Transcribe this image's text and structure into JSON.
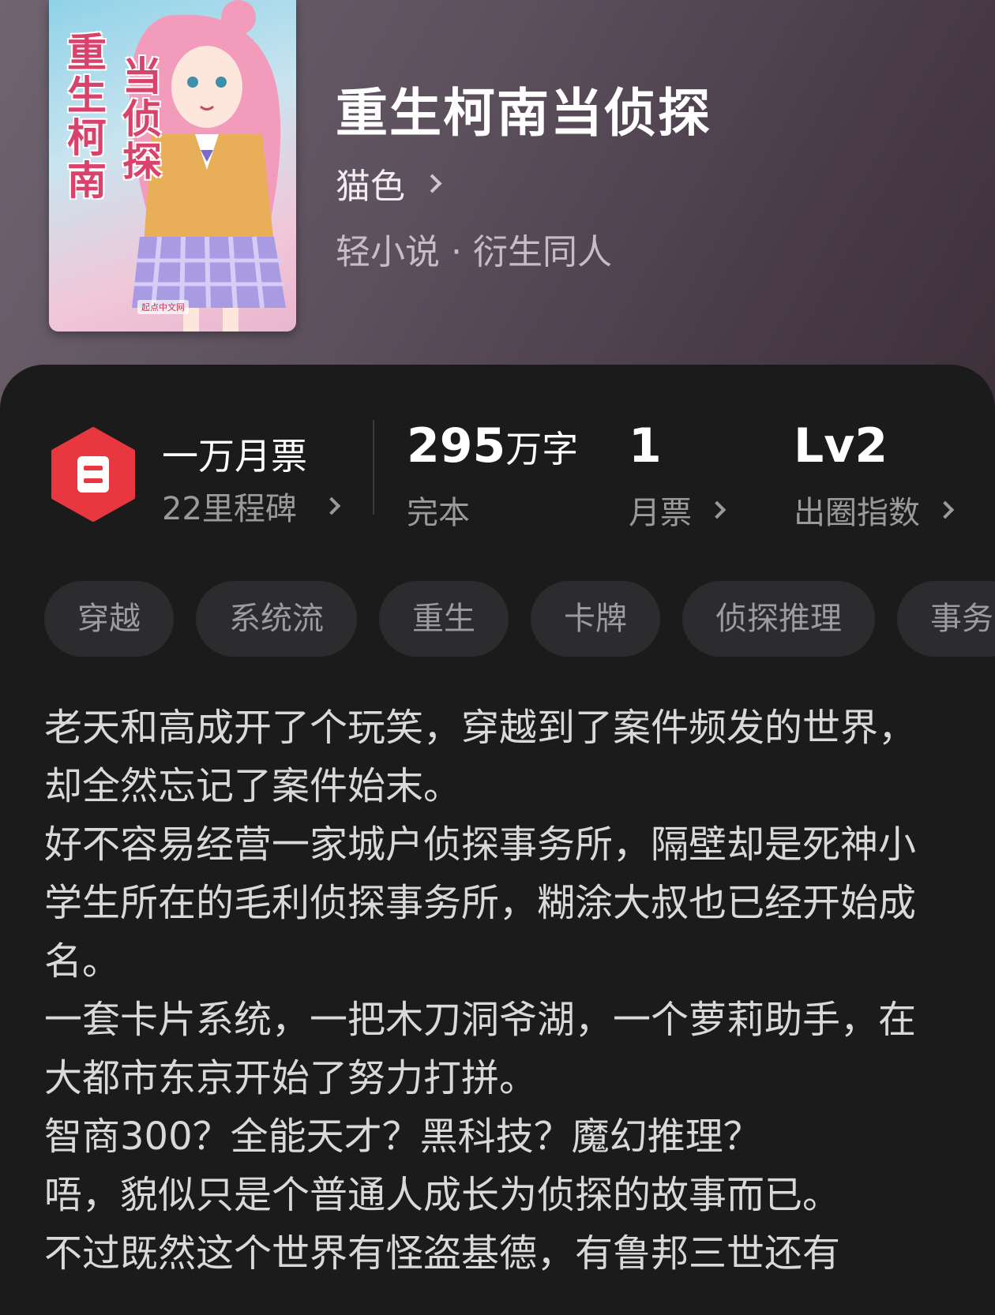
{
  "book": {
    "title": "重生柯南当侦探",
    "author": "猫色",
    "genre": "轻小说 · 衍生同人",
    "cover": {
      "title_col1": "重生柯南",
      "title_col2": "当侦探",
      "brand": "起点中文网"
    }
  },
  "stats": {
    "monthly_ticket_title": "一万月票",
    "milestone": "22里程碑",
    "word_count_value": "295",
    "word_count_unit": "万字",
    "word_count_label": "完本",
    "monthly_votes_value": "1",
    "monthly_votes_label": "月票",
    "circle_index_value": "Lv2",
    "circle_index_label": "出圈指数"
  },
  "tags": [
    "穿越",
    "系统流",
    "重生",
    "卡牌",
    "侦探推理",
    "事务"
  ],
  "synopsis": "老天和高成开了个玩笑，穿越到了案件频发的世界，却全然忘记了案件始末。\n好不容易经营一家城户侦探事务所，隔壁却是死神小学生所在的毛利侦探事务所，糊涂大叔也已经开始成名。\n一套卡片系统，一把木刀洞爷湖，一个萝莉助手，在大都市东京开始了努力打拼。\n智商300？全能天才？黑科技？魔幻推理？\n唔，貌似只是个普通人成长为侦探的故事而已。\n不过既然这个世界有怪盗基德，有鲁邦三世还有",
  "colors": {
    "background": "#1b1b1c",
    "ticket_red": "#e8373f",
    "tag_bg": "#2c2c2e",
    "muted_text": "#9a9a9c"
  },
  "icons": {
    "ticket_badge": "hexagon-ticket-icon",
    "chevron": "chevron-right-icon"
  }
}
